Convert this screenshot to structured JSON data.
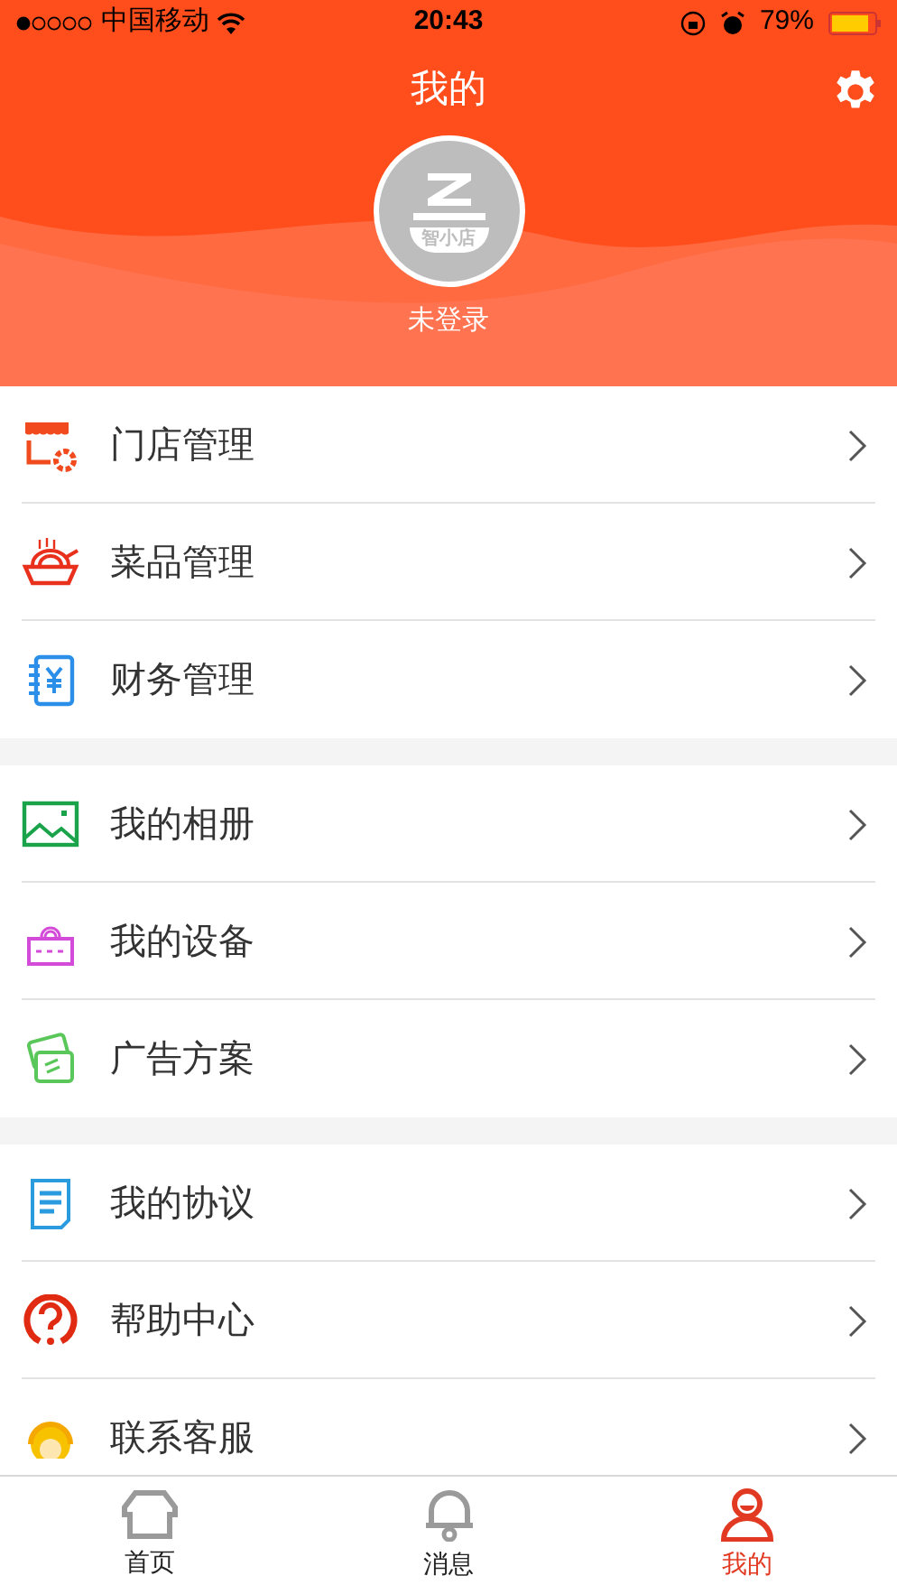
{
  "status_bar": {
    "carrier": "中国移动",
    "time": "20:43",
    "battery": "79%"
  },
  "header": {
    "title": "我的",
    "avatar_logo": "智小店",
    "login_status": "未登录"
  },
  "menu_groups": [
    {
      "items": [
        {
          "label": "门店管理"
        },
        {
          "label": "菜品管理"
        },
        {
          "label": "财务管理"
        }
      ]
    },
    {
      "items": [
        {
          "label": "我的相册"
        },
        {
          "label": "我的设备"
        },
        {
          "label": "广告方案"
        }
      ]
    },
    {
      "items": [
        {
          "label": "我的协议"
        },
        {
          "label": "帮助中心"
        },
        {
          "label": "联系客服"
        }
      ]
    }
  ],
  "tab_bar": [
    {
      "label": "首页",
      "selected": false
    },
    {
      "label": "消息",
      "selected": false
    },
    {
      "label": "我的",
      "selected": true
    }
  ]
}
